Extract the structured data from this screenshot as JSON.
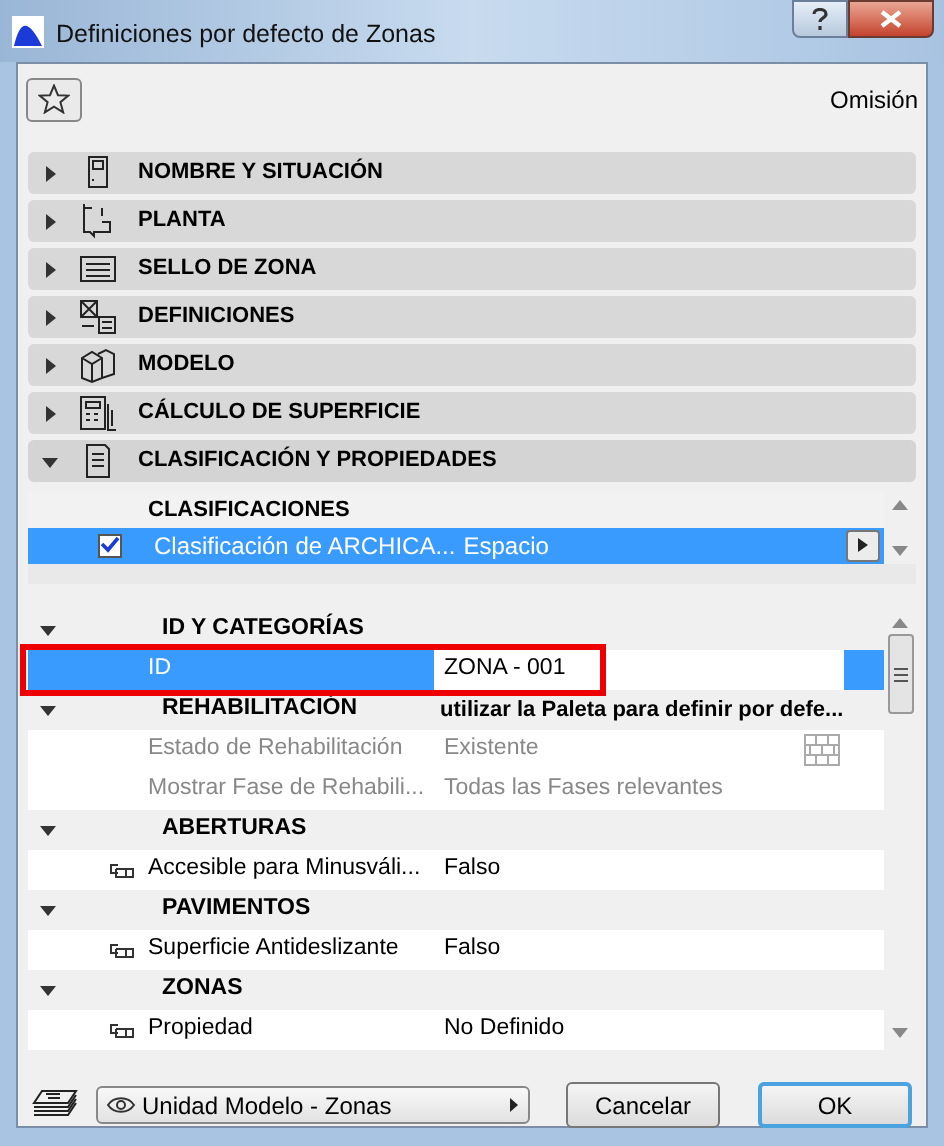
{
  "window": {
    "title": "Definiciones por defecto de Zonas"
  },
  "favorites": {
    "omission": "Omisión"
  },
  "sections": [
    {
      "label": "NOMBRE Y SITUACIÓN",
      "kind": "name",
      "expanded": false
    },
    {
      "label": "PLANTA",
      "kind": "plan",
      "expanded": false
    },
    {
      "label": "SELLO DE ZONA",
      "kind": "stamp",
      "expanded": false
    },
    {
      "label": "DEFINICIONES",
      "kind": "defs",
      "expanded": false
    },
    {
      "label": "MODELO",
      "kind": "model",
      "expanded": false
    },
    {
      "label": "CÁLCULO DE SUPERFICIE",
      "kind": "calc",
      "expanded": false
    },
    {
      "label": "CLASIFICACIÓN Y PROPIEDADES",
      "kind": "doc",
      "expanded": true
    }
  ],
  "classifications": {
    "header": "CLASIFICACIONES",
    "rows": [
      {
        "name": "Clasificación de ARCHICA...",
        "value": "Espacio",
        "checked": true,
        "selected": true
      }
    ]
  },
  "property_groups": [
    {
      "title": "ID Y CATEGORÍAS",
      "expanded": true,
      "items": [
        {
          "label": "ID",
          "value": "ZONA - 001",
          "selected": true,
          "highlighted": true,
          "disabled": false
        }
      ]
    },
    {
      "title": "REHABILITACIÓN",
      "value": "utilizar la Paleta para definir por defe...",
      "expanded": true,
      "items": [
        {
          "label": "Estado de Rehabilitación",
          "value": "Existente",
          "selected": false,
          "highlighted": false,
          "disabled": true,
          "kind": "wall"
        },
        {
          "label": "Mostrar Fase de Rehabili...",
          "value": "Todas las Fases relevantes",
          "selected": false,
          "highlighted": false,
          "disabled": true
        }
      ]
    },
    {
      "title": "ABERTURAS",
      "expanded": true,
      "items": [
        {
          "label": "Accesible para Minusváli...",
          "value": "Falso",
          "selected": false,
          "highlighted": false,
          "disabled": false,
          "kind": "linked"
        }
      ]
    },
    {
      "title": "PAVIMENTOS",
      "expanded": true,
      "items": [
        {
          "label": "Superficie Antideslizante",
          "value": "Falso",
          "selected": false,
          "highlighted": false,
          "disabled": false,
          "kind": "linked"
        }
      ]
    },
    {
      "title": "ZONAS",
      "expanded": true,
      "items": [
        {
          "label": "Propiedad",
          "value": "No Definido",
          "selected": false,
          "highlighted": false,
          "disabled": false,
          "kind": "linked"
        }
      ]
    }
  ],
  "footer": {
    "layer": "Unidad Modelo - Zonas",
    "buttons": [
      {
        "label": "Cancelar",
        "default": false
      },
      {
        "label": "OK",
        "default": true
      }
    ]
  }
}
